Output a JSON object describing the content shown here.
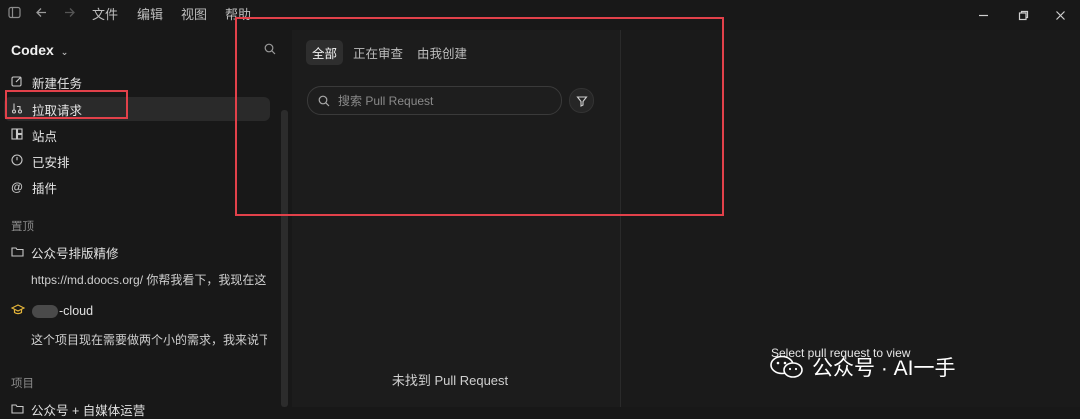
{
  "titlebar": {
    "menu": [
      "文件",
      "编辑",
      "视图",
      "帮助"
    ],
    "icons": [
      "sidebar-toggle-icon",
      "back-arrow-icon",
      "forward-arrow-icon",
      "minimize-icon",
      "restore-icon",
      "close-icon"
    ]
  },
  "sidebar": {
    "app_name": "Codex",
    "nav": [
      {
        "label": "新建任务",
        "icon": "edit-icon"
      },
      {
        "label": "拉取请求",
        "icon": "pull-request-icon"
      },
      {
        "label": "站点",
        "icon": "sites-icon"
      },
      {
        "label": "已安排",
        "icon": "clock-icon"
      },
      {
        "label": "插件",
        "icon": "at-icon"
      }
    ],
    "pinned_label": "置顶",
    "pinned": [
      {
        "title": "公众号排版精修",
        "snippet": "https://md.doocs.org/ 你帮我看下，我现在这"
      },
      {
        "title": "-cloud",
        "snippet": "这个项目现在需要做两个小的需求，我来说下"
      }
    ],
    "projects_label": "项目",
    "projects": [
      {
        "title": "公众号 + 自媒体运营"
      }
    ]
  },
  "center": {
    "tabs": [
      "全部",
      "正在审查",
      "由我创建"
    ],
    "search_placeholder": "搜索 Pull Request",
    "empty_text": "未找到 Pull Request"
  },
  "right": {
    "placeholder_text": "Select pull request to view"
  },
  "watermark": {
    "text": "公众号 · AI一手"
  },
  "colors": {
    "background": "#181818",
    "annotation": "#e2414a",
    "active_item": "#2a2a2a"
  }
}
